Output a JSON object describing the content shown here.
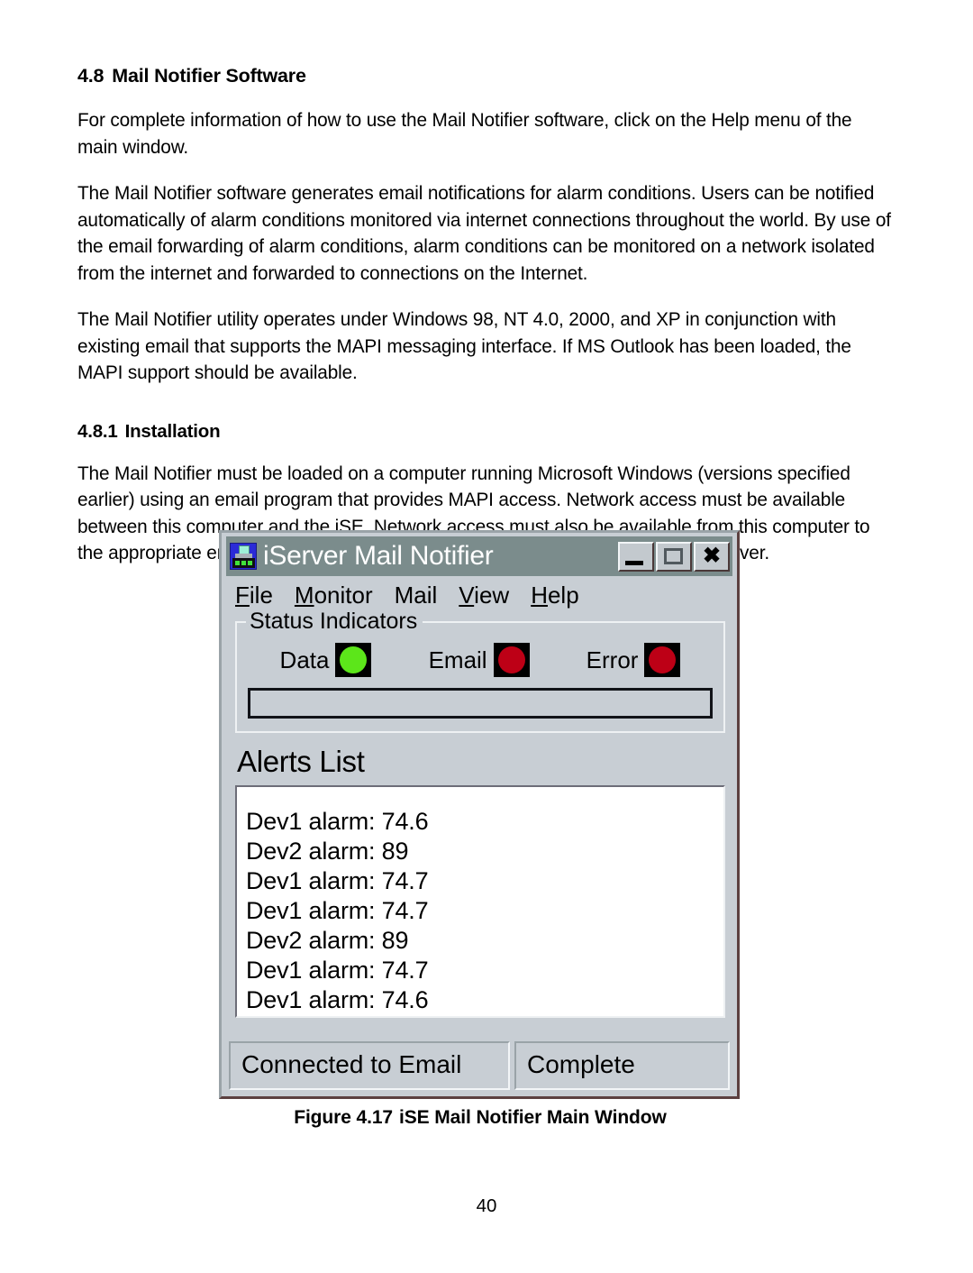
{
  "document": {
    "section": {
      "number": "4.8",
      "title": "Mail Notifier Software"
    },
    "paragraphs": [
      "For complete information of how to use the Mail Notifier software, click on the Help menu of the main window.",
      "The Mail Notifier software generates email notifications for alarm conditions. Users can be notified automatically of alarm conditions monitored via internet connections throughout the world. By use of the email forwarding of alarm conditions, alarm conditions can be monitored on a network isolated from the internet and forwarded to connections on the Internet.",
      "The Mail Notifier utility operates under Windows 98, NT 4.0, 2000, and XP in conjunction with existing email that supports the MAPI messaging interface. If MS Outlook has been loaded, the MAPI support should be available."
    ],
    "subsection": {
      "number": "4.8.1",
      "title": "Installation",
      "paragraph": "The Mail Notifier must be loaded on a computer running Microsoft Windows (versions specified earlier) using an email program that provides MAPI access. Network access must be available between this computer and the iSE. Network access must also be available from this computer to the appropriate email server and from the email server to the recipient’s email server."
    },
    "figure": {
      "caption_number": "Figure 4.17",
      "caption_text": "iSE Mail Notifier Main Window"
    },
    "page_number": "40"
  },
  "app_window": {
    "title": "iServer Mail Notifier",
    "icon": "iserver-device-icon",
    "window_buttons": {
      "minimize": "minimize-icon",
      "maximize": "maximize-icon",
      "close": "✖"
    },
    "menu": [
      {
        "accel": "F",
        "rest": "ile"
      },
      {
        "accel": "M",
        "rest": "onitor"
      },
      {
        "accel": "",
        "rest": "Mail"
      },
      {
        "accel": "V",
        "rest": "iew"
      },
      {
        "accel": "H",
        "rest": "elp"
      }
    ],
    "status_indicators": {
      "group_title": "Status Indicators",
      "leds": [
        {
          "label": "Data",
          "color": "#5ce61a",
          "state": "on"
        },
        {
          "label": "Email",
          "color": "#bd0016",
          "state": "off"
        },
        {
          "label": "Error",
          "color": "#bd0016",
          "state": "off"
        }
      ],
      "message_field_value": ""
    },
    "alerts": {
      "title": "Alerts List",
      "items": [
        "Dev1 alarm: 74.6",
        "Dev2 alarm: 89",
        "Dev1 alarm: 74.7",
        "Dev1 alarm: 74.7",
        "Dev2 alarm: 89",
        "Dev1 alarm: 74.7",
        "Dev1 alarm: 74.6"
      ]
    },
    "statusbar": {
      "panel1": "Connected to Email",
      "panel2": "Complete"
    },
    "colors": {
      "titlebar": "#7b8c8c",
      "window_face": "#c8ced4",
      "led_on": "#5ce61a",
      "led_off": "#bd0016"
    }
  }
}
